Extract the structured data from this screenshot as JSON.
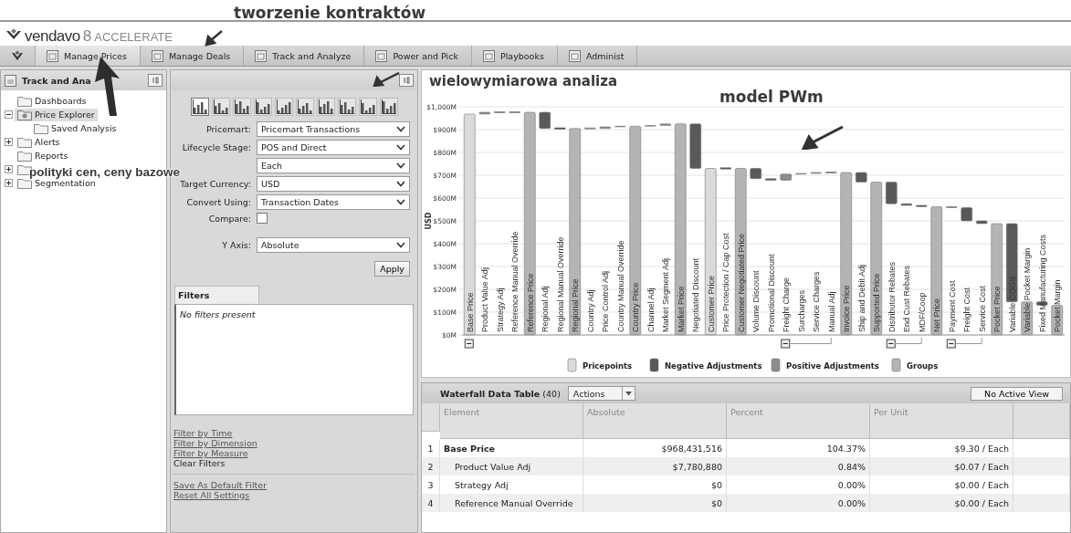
{
  "annotations": [
    {
      "text": "tworzenie kontraktów"
    },
    {
      "text": "wielowymiarowa analiza"
    },
    {
      "text": "polityki cen, ceny bazowe"
    },
    {
      "text": "model PWm"
    }
  ],
  "logo": {
    "brand": "vendavo",
    "version": "8",
    "product": "ACCELERATE"
  },
  "nav": [
    {
      "label": "Manage Prices",
      "selected": true
    },
    {
      "label": "Manage Deals",
      "selected": false
    },
    {
      "label": "Track and Analyze",
      "selected": false
    },
    {
      "label": "Power and Pick",
      "selected": false
    },
    {
      "label": "Playbooks",
      "selected": false
    },
    {
      "label": "Administ",
      "selected": false
    }
  ],
  "left_panel": {
    "title": "Track and Ana",
    "tree": [
      {
        "label": "Dashboards",
        "kind": "folder",
        "selected": false
      },
      {
        "label": "Price Explorer",
        "kind": "explorer",
        "selected": true,
        "expanded": true,
        "children": [
          {
            "label": "Saved Analysis",
            "kind": "folder",
            "selected": false
          }
        ]
      },
      {
        "label": "Alerts",
        "kind": "folder",
        "selected": false,
        "expanded": false
      },
      {
        "label": "Reports",
        "kind": "folder",
        "selected": false
      },
      {
        "kind": "folder",
        "selected": false,
        "expanded": false
      },
      {
        "label": "Segmentation",
        "kind": "folder",
        "selected": false,
        "expanded": false
      }
    ]
  },
  "analysis_panel": {
    "chart_types": [
      {
        "selected": true
      },
      {
        "selected": false
      },
      {
        "selected": false
      },
      {
        "selected": false
      },
      {
        "selected": false
      },
      {
        "selected": false
      },
      {
        "selected": false
      },
      {
        "selected": false
      },
      {
        "selected": false
      },
      {
        "selected": false
      }
    ],
    "fields": [
      {
        "label": "Pricemart:",
        "value": "Pricemart Transactions"
      },
      {
        "label": "Lifecycle Stage:",
        "value": "POS and Direct"
      },
      {
        "value": "Each"
      },
      {
        "label": "Target Currency:",
        "value": "USD"
      },
      {
        "label": "Convert Using:",
        "value": "Transaction Dates"
      }
    ],
    "compare": {
      "label": "Compare:",
      "checked": false
    },
    "y_axis": {
      "label": "Y Axis:",
      "value": "Absolute"
    },
    "apply": "Apply",
    "filters_tab": "Filters",
    "filters_empty": "No filters present",
    "filter_links": [
      {
        "text": "Filter by Time",
        "kind": "link"
      },
      {
        "text": "Filter by Dimension",
        "kind": "link"
      },
      {
        "text": "Filter by Measure",
        "kind": "link"
      },
      {
        "text": "Clear Filters",
        "kind": "plain"
      }
    ],
    "settings_links": [
      {
        "text": "Save As Default Filter",
        "kind": "link"
      },
      {
        "text": "Reset All Settings",
        "kind": "link"
      }
    ]
  },
  "chart": {
    "chart_data": {
      "type": "candlestick",
      "ylabel": "USD",
      "ylim": [
        0,
        1000
      ],
      "grid": true,
      "legend": "bottom",
      "yticks": [
        {
          "value": 0,
          "label": "$0M"
        },
        {
          "value": 100,
          "label": "$100M"
        },
        {
          "value": 200,
          "label": "$200M"
        },
        {
          "value": 300,
          "label": "$300M"
        },
        {
          "value": 400,
          "label": "$400M"
        },
        {
          "value": 500,
          "label": "$500M"
        },
        {
          "value": 600,
          "label": "$600M"
        },
        {
          "value": 700,
          "label": "$700M"
        },
        {
          "value": 800,
          "label": "$800M"
        },
        {
          "value": 900,
          "label": "$900M"
        },
        {
          "value": 1000,
          "label": "$1,000M"
        }
      ],
      "categories": [
        "Base Price",
        "Product Value Adj",
        "Strategy Adj",
        "Reference Manual Override",
        "Reference Price",
        "Regional Adj",
        "Regional Manual Override",
        "Regional Price",
        "Country Adj",
        "Price Control Adj",
        "Country Manual Override",
        "Country Price",
        "Channel Adj",
        "Market Segment Adj",
        "Market Price",
        "Negotiated Discount",
        "Customer Price",
        "Price Protection / Cap Cost",
        "Customer Negotiated Price",
        "Volume Discount",
        "Promotional Discount",
        "Freight Charge",
        "Surcharges",
        "Service Charges",
        "Manual Adj",
        "Invoice Price",
        "Ship and Debit Adj",
        "Supported Price",
        "Distributor Rebates",
        "End Cust Rebates",
        "MDF/Coop",
        "Net Price",
        "Payment Cost",
        "Freight Cost",
        "Service Cost",
        "Pocket Price",
        "Variable COGS",
        "Variable Pocket Margin",
        "Fixed Manufacturing Costs",
        "Pocket Margin"
      ],
      "series": [
        {
          "name": "Pricepoints",
          "color": "#dadada",
          "ohlc": [
            [
              0,
              968,
              0,
              968
            ],
            null,
            null,
            null,
            null,
            null,
            null,
            null,
            null,
            null,
            null,
            null,
            null,
            null,
            null,
            null,
            [
              0,
              730,
              0,
              730
            ],
            null,
            null,
            null,
            null,
            null,
            null,
            null,
            null,
            null,
            null,
            null,
            null,
            null,
            null,
            null,
            null,
            null,
            null,
            null,
            null,
            null,
            null,
            null
          ]
        },
        {
          "name": "Negative Adjustments",
          "color": "#595959",
          "ohlc": [
            null,
            null,
            null,
            null,
            null,
            [
              976,
              976,
              905,
              905
            ],
            [
              905,
              905,
              905,
              905
            ],
            null,
            null,
            null,
            null,
            null,
            null,
            null,
            null,
            [
              925,
              925,
              730,
              730
            ],
            null,
            [
              730,
              730,
              730,
              730
            ],
            null,
            [
              730,
              730,
              685,
              685
            ],
            [
              685,
              685,
              678,
              678
            ],
            null,
            null,
            null,
            null,
            null,
            [
              712,
              712,
              670,
              670
            ],
            null,
            [
              670,
              670,
              575,
              575
            ],
            [
              575,
              575,
              568,
              568
            ],
            [
              568,
              568,
              562,
              562
            ],
            null,
            [
              562,
              562,
              558,
              558
            ],
            [
              558,
              558,
              500,
              500
            ],
            [
              500,
              500,
              488,
              488
            ],
            null,
            [
              488,
              488,
              145,
              145
            ],
            null,
            [
              145,
              145,
              130,
              130
            ],
            null
          ]
        },
        {
          "name": "Positive Adjustments",
          "color": "#8c8c8c",
          "ohlc": [
            null,
            [
              968,
              976,
              968,
              976
            ],
            [
              976,
              976,
              976,
              976
            ],
            [
              976,
              976,
              976,
              976
            ],
            null,
            null,
            null,
            null,
            [
              905,
              905,
              905,
              905
            ],
            [
              905,
              912,
              905,
              912
            ],
            [
              912,
              915,
              912,
              915
            ],
            null,
            [
              915,
              918,
              915,
              918
            ],
            [
              918,
              925,
              918,
              925
            ],
            null,
            null,
            null,
            null,
            null,
            null,
            null,
            [
              678,
              705,
              678,
              705
            ],
            [
              705,
              708,
              705,
              708
            ],
            [
              708,
              712,
              708,
              712
            ],
            [
              712,
              712,
              712,
              712
            ],
            null,
            null,
            null,
            null,
            null,
            null,
            null,
            null,
            null,
            null,
            null,
            null,
            null,
            null,
            null
          ]
        },
        {
          "name": "Groups",
          "color": "#b4b4b4",
          "ohlc": [
            null,
            null,
            null,
            null,
            [
              0,
              976,
              0,
              976
            ],
            null,
            null,
            [
              0,
              905,
              0,
              905
            ],
            null,
            null,
            null,
            [
              0,
              915,
              0,
              915
            ],
            null,
            null,
            [
              0,
              925,
              0,
              925
            ],
            null,
            null,
            null,
            [
              0,
              730,
              0,
              730
            ],
            null,
            null,
            null,
            null,
            null,
            null,
            [
              0,
              712,
              0,
              712
            ],
            null,
            [
              0,
              670,
              0,
              670
            ],
            null,
            null,
            null,
            [
              0,
              562,
              0,
              562
            ],
            null,
            null,
            null,
            [
              0,
              488,
              0,
              488
            ],
            null,
            [
              0,
              145,
              0,
              145
            ],
            null,
            [
              0,
              130,
              0,
              130
            ]
          ]
        }
      ]
    }
  },
  "table": {
    "title": "Waterfall Data Table",
    "count": "(40)",
    "actions": "Actions",
    "view": "No Active View",
    "columns": [
      "Element",
      "Absolute",
      "Percent",
      "Per Unit"
    ],
    "rows": [
      {
        "index": "1",
        "element": "Base Price",
        "absolute": "$968,431,516",
        "percent": "104.37%",
        "per_unit": "$9.30 / Each",
        "kind": "group"
      },
      {
        "index": "2",
        "element": "Product Value Adj",
        "absolute": "$7,780,880",
        "percent": "0.84%",
        "per_unit": "$0.07 / Each",
        "kind": "item"
      },
      {
        "index": "3",
        "element": "Strategy Adj",
        "absolute": "$0",
        "percent": "0.00%",
        "per_unit": "$0.00 / Each",
        "kind": "item"
      },
      {
        "index": "4",
        "element": "Reference Manual Override",
        "absolute": "$0",
        "percent": "0.00%",
        "per_unit": "$0.00 / Each",
        "kind": "item"
      }
    ]
  }
}
